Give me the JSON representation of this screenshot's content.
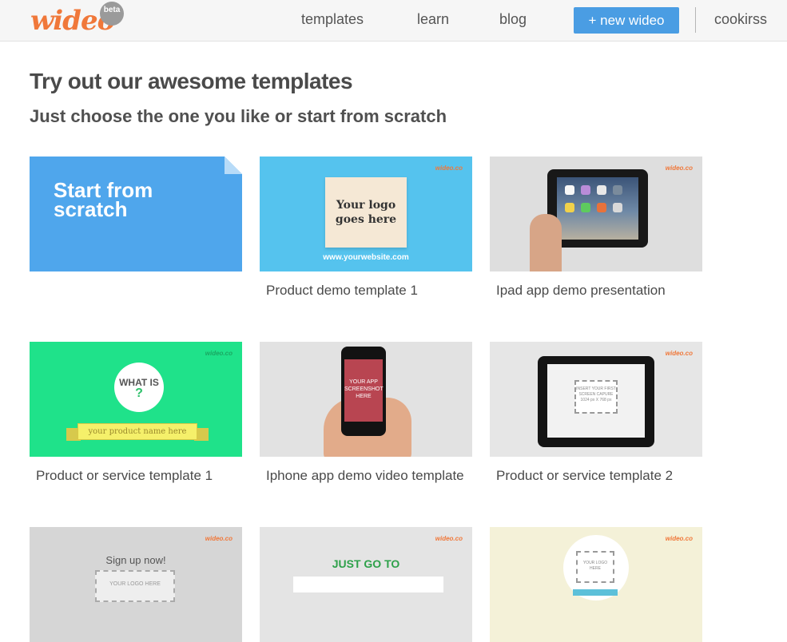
{
  "header": {
    "logo": "wideo",
    "beta": "beta",
    "nav": [
      "templates",
      "learn",
      "blog"
    ],
    "new_button": "+ new wideo",
    "user": "cookirss"
  },
  "page": {
    "title": "Try out our awesome templates",
    "subtitle": "Just choose the one you like or start from scratch"
  },
  "cards": [
    {
      "label": "",
      "thumb_text": "Start from scratch"
    },
    {
      "label": "Product demo template 1",
      "thumb_text": "Your logo goes here",
      "thumb_sub": "www.yourwebsite.com"
    },
    {
      "label": "Ipad app demo presentation"
    },
    {
      "label": "Product or service template 1",
      "thumb_text": "WHAT IS",
      "thumb_q": "?",
      "thumb_sub": "your product name here"
    },
    {
      "label": "Iphone app demo video template",
      "thumb_text": "YOUR APP SCREENSHOT HERE"
    },
    {
      "label": "Product or service template 2",
      "thumb_text": "INSERT YOUR FIRST SCREEN CAPURE",
      "thumb_sub": "1024 px X 768 px"
    },
    {
      "label": "",
      "thumb_text": "Sign up now!",
      "thumb_sub": "YOUR LOGO HERE"
    },
    {
      "label": "",
      "thumb_text": "JUST GO TO"
    },
    {
      "label": "",
      "thumb_text": "YOUR LOGO HERE"
    }
  ],
  "brand_mark": "wideo.co",
  "colors": {
    "accent": "#f0783a",
    "button": "#4a9de3",
    "scratch": "#4fa6ec"
  }
}
